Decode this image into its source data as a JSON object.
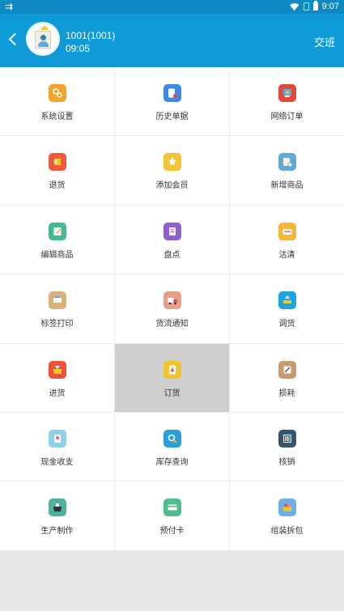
{
  "status": {
    "time": "9:07",
    "left_icon": "cast-icon"
  },
  "header": {
    "user": "1001(1001)",
    "time": "09:05",
    "shift_button": "交班"
  },
  "grid": [
    [
      {
        "label": "系统设置",
        "icon": "gears-icon",
        "color": "#f0a52a"
      },
      {
        "label": "历史单据",
        "icon": "history-doc-icon",
        "color": "#3a8ae6"
      },
      {
        "label": "网络订单",
        "icon": "network-order-icon",
        "color": "#e24b3b"
      }
    ],
    [
      {
        "label": "退货",
        "icon": "return-icon",
        "color": "#ef5b3a"
      },
      {
        "label": "添加会员",
        "icon": "vip-icon",
        "color": "#f2c538"
      },
      {
        "label": "新增商品",
        "icon": "new-product-icon",
        "color": "#62a9d9"
      }
    ],
    [
      {
        "label": "编辑商品",
        "icon": "edit-product-icon",
        "color": "#45b98f"
      },
      {
        "label": "盘点",
        "icon": "inventory-check-icon",
        "color": "#8f5fcf"
      },
      {
        "label": "沽清",
        "icon": "sold-out-icon",
        "color": "#f4b63c"
      }
    ],
    [
      {
        "label": "标签打印",
        "icon": "label-print-icon",
        "color": "#d8b27a"
      },
      {
        "label": "货流通知",
        "icon": "logistics-icon",
        "color": "#e7a08a"
      },
      {
        "label": "调货",
        "icon": "transfer-icon",
        "color": "#1fa3e0"
      }
    ],
    [
      {
        "label": "进货",
        "icon": "purchase-icon",
        "color": "#ef5138"
      },
      {
        "label": "订货",
        "icon": "order-goods-icon",
        "color": "#f0c230"
      },
      {
        "label": "损耗",
        "icon": "loss-icon",
        "color": "#c99a6c"
      }
    ],
    [
      {
        "label": "现金收支",
        "icon": "cash-icon",
        "color": "#8fd1e8"
      },
      {
        "label": "库存查询",
        "icon": "stock-search-icon",
        "color": "#2b9edb"
      },
      {
        "label": "核销",
        "icon": "verify-icon",
        "color": "#35546f"
      }
    ],
    [
      {
        "label": "生产制作",
        "icon": "production-icon",
        "color": "#4bb3a0"
      },
      {
        "label": "预付卡",
        "icon": "prepaid-card-icon",
        "color": "#4fbe8c"
      },
      {
        "label": "组装拆包",
        "icon": "assemble-icon",
        "color": "#6cb0e6"
      }
    ]
  ]
}
